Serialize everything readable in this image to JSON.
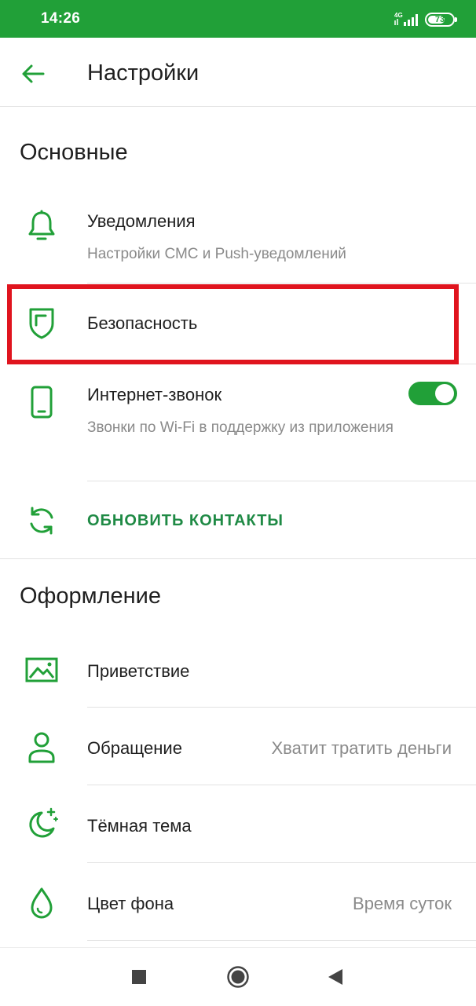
{
  "status_bar": {
    "time": "14:26",
    "network": "4G",
    "battery": "73",
    "battery_level": 0.73
  },
  "header": {
    "title": "Настройки",
    "back_icon": "arrow-left-icon"
  },
  "colors": {
    "brand_green": "#21a038",
    "accent_green": "#1f8a45",
    "highlight_red": "#e0141e",
    "secondary_text": "#8a8a8a"
  },
  "sections": {
    "main": {
      "title": "Основные",
      "notifications": {
        "title": "Уведомления",
        "subtitle": "Настройки СМС и Push-уведомлений",
        "icon": "bell-icon"
      },
      "security": {
        "title": "Безопасность",
        "icon": "shield-icon"
      },
      "internet_call": {
        "title": "Интернет-звонок",
        "subtitle": "Звонки по Wi-Fi в поддержку из приложения",
        "icon": "phone-icon",
        "enabled": true
      },
      "update_contacts": {
        "label": "ОБНОВИТЬ КОНТАКТЫ",
        "icon": "refresh-icon"
      }
    },
    "appearance": {
      "title": "Оформление",
      "greeting": {
        "title": "Приветствие",
        "icon": "picture-icon"
      },
      "address": {
        "title": "Обращение",
        "value": "Хватит тратить деньги",
        "icon": "person-icon"
      },
      "dark_theme": {
        "title": "Тёмная тема",
        "icon": "moon-icon"
      },
      "background_color": {
        "title": "Цвет фона",
        "value": "Время суток",
        "icon": "drop-icon"
      }
    }
  },
  "nav_bar": {
    "recents_icon": "square-icon",
    "home_icon": "circle-icon",
    "back_icon": "triangle-back-icon"
  }
}
